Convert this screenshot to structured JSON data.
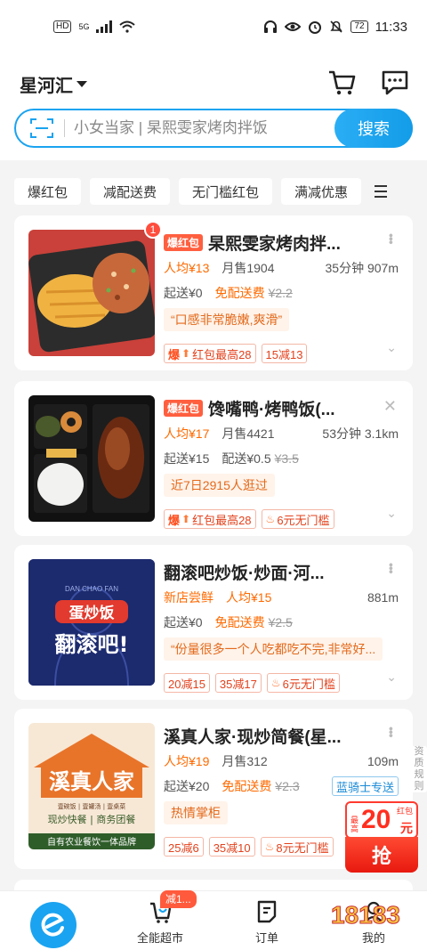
{
  "status_bar": {
    "left_badge": "HD",
    "network": "5G",
    "battery": "72",
    "time": "11:33"
  },
  "header": {
    "city": "星河汇",
    "search_placeholder": "小女当家 | 杲熙雯家烤肉拌饭",
    "search_button": "搜索"
  },
  "filters": [
    "爆红包",
    "减配送费",
    "无门槛红包",
    "满减优惠"
  ],
  "shops": [
    {
      "badge_count": "1",
      "tag": "爆红包",
      "name": "杲熙雯家烤肉拌...",
      "per_capita": "人均¥13",
      "monthly": "月售1904",
      "time_dist": "35分钟 907m",
      "min_order": "起送¥0",
      "delivery": "免配送费",
      "delivery_old": "¥2.2",
      "quote": "“口感非常脆嫩,爽滑”",
      "promos": [
        "红包最高28",
        "15减13"
      ],
      "promo_prefix": "爆"
    },
    {
      "tag": "爆红包",
      "name": "馋嘴鸭·烤鸭饭(...",
      "per_capita": "人均¥17",
      "monthly": "月售4421",
      "time_dist": "53分钟 3.1km",
      "min_order": "起送¥15",
      "delivery": "配送¥0.5",
      "delivery_old": "¥3.5",
      "quote": "近7日2915人逛过",
      "promos": [
        "红包最高28",
        "6元无门槛"
      ],
      "promo_prefix": "爆"
    },
    {
      "name": "翻滚吧炒饭·炒面·河...",
      "new_label": "新店尝鲜",
      "per_capita": "人均¥15",
      "time_dist": "881m",
      "min_order": "起送¥0",
      "delivery": "免配送费",
      "delivery_old": "¥2.5",
      "quote": "“份量很多一个人吃都吃不完,非常好...",
      "promos": [
        "20减15",
        "35减17",
        "6元无门槛"
      ],
      "thumb_en": "DAN CHAO FAN",
      "thumb_line1": "蛋炒饭",
      "thumb_line2": "翻滚吧!"
    },
    {
      "name": "溪真人家·现炒简餐(星...",
      "per_capita": "人均¥19",
      "monthly": "月售312",
      "time_dist": "109m",
      "min_order": "起送¥20",
      "delivery": "免配送费",
      "delivery_old": "¥2.3",
      "rider": "蓝骑士专送",
      "quote": "热情掌柜",
      "promos": [
        "25减6",
        "35减10",
        "8元无门槛"
      ],
      "thumb_title": "溪真人家",
      "thumb_sub": "壹碗饭 | 壹罐汤 | 壹桌菜",
      "thumb_mid": "现炒快餐 | 商务团餐",
      "thumb_foot": "自有农业餐饮一体品牌"
    }
  ],
  "redpack": {
    "small": "最高",
    "tag": "红包",
    "amount": "20",
    "unit": "元",
    "grab": "抢"
  },
  "side_note": "资质规则",
  "tabbar": {
    "supermarket": "全能超市",
    "supermarket_badge": "减1...",
    "orders": "订单",
    "mine": "我的"
  },
  "watermark": "18183",
  "colors": {
    "brand_blue": "#1aa3f0",
    "accent_red": "#ff4d3d",
    "orange": "#ff6a00"
  }
}
